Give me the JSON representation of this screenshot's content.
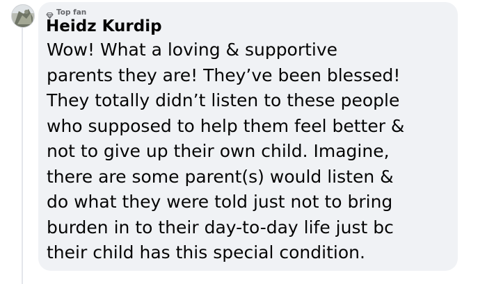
{
  "comment": {
    "badge": {
      "icon": "diamond-icon",
      "label": "Top fan"
    },
    "author": "Heidz Kurdip",
    "body_lines": [
      "Wow! What a loving & supportive",
      "parents they are! They’ve been blessed!",
      "They totally didn’t listen to these people",
      "who supposed to help them feel better &",
      "not to give up their own child. Imagine,",
      "there are some parent(s) would listen &",
      "do what they were told just not to bring",
      "burden in to their day-to-day life just bc",
      "their child has this special condition."
    ]
  },
  "colors": {
    "bubble_background": "#f0f2f5",
    "text": "#050505",
    "secondary_text": "#65676b"
  }
}
